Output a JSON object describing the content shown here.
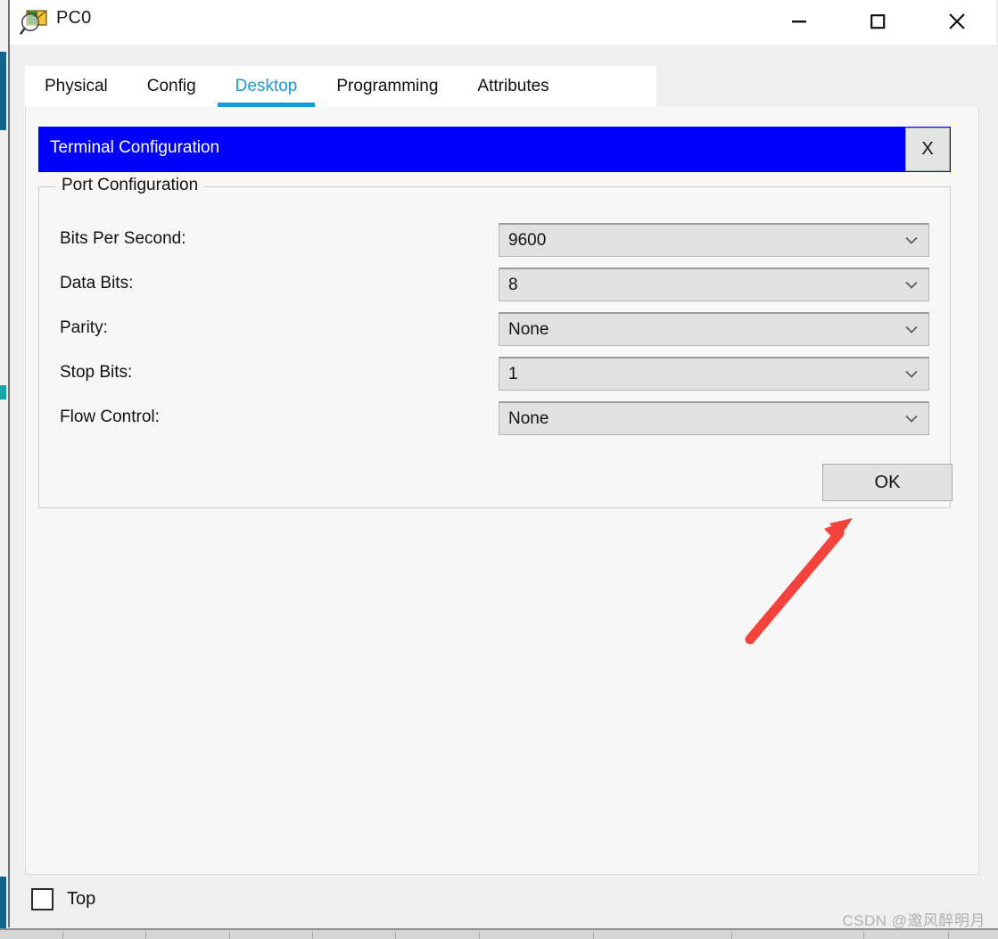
{
  "window": {
    "title": "PC0",
    "icon": "packet-tracer-inspect-icon",
    "controls": {
      "minimize": "minimize-icon",
      "maximize": "maximize-icon",
      "close": "close-icon"
    }
  },
  "tabs": [
    {
      "label": "Physical",
      "active": false
    },
    {
      "label": "Config",
      "active": false
    },
    {
      "label": "Desktop",
      "active": true
    },
    {
      "label": "Programming",
      "active": false
    },
    {
      "label": "Attributes",
      "active": false
    }
  ],
  "dialog": {
    "title": "Terminal Configuration",
    "close_label": "X",
    "group_legend": "Port Configuration",
    "fields": [
      {
        "label": "Bits Per Second:",
        "value": "9600"
      },
      {
        "label": "Data Bits:",
        "value": "8"
      },
      {
        "label": "Parity:",
        "value": "None"
      },
      {
        "label": "Stop Bits:",
        "value": "1"
      },
      {
        "label": "Flow Control:",
        "value": "None"
      }
    ],
    "ok_label": "OK"
  },
  "bottom": {
    "top_checkbox_label": "Top",
    "top_checkbox_checked": false
  },
  "watermark": "CSDN @邀风醉明月",
  "colors": {
    "accent_tab": "#1a9ad6",
    "dialog_header": "#0000FF",
    "annotation_arrow": "#f4423c",
    "window_bg": "#efefef",
    "panel_bg": "#f7f7f7",
    "combo_bg": "#e1e1e1"
  }
}
